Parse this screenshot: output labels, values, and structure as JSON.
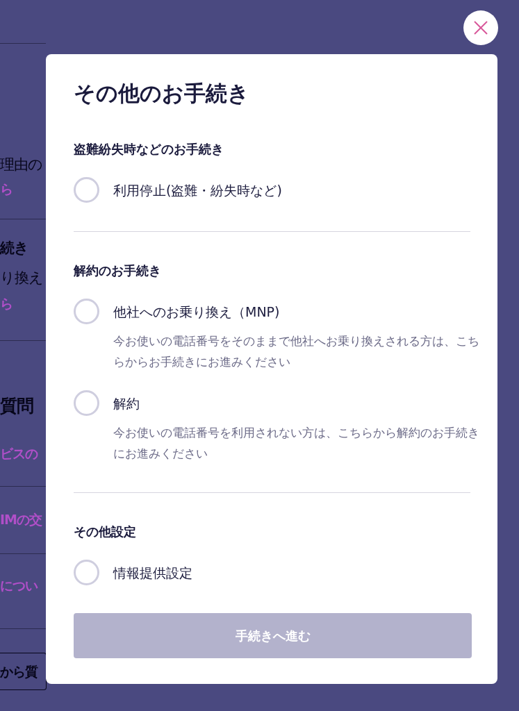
{
  "background": [
    {
      "kind": "text",
      "text": "理由の"
    },
    {
      "kind": "link",
      "text": "ら"
    },
    {
      "kind": "heading",
      "text": "続き"
    },
    {
      "kind": "text",
      "text": "り換え"
    },
    {
      "kind": "link",
      "text": "ら"
    },
    {
      "kind": "title",
      "text": "質問"
    },
    {
      "kind": "link",
      "text": "ビスの"
    },
    {
      "kind": "link",
      "text": "IMの交"
    },
    {
      "kind": "link",
      "text": "につい"
    },
    {
      "kind": "button",
      "text": "から質"
    }
  ],
  "dialog": {
    "title": "その他のお手続き",
    "sections": [
      {
        "heading": "盗難紛失時などのお手続き",
        "options": [
          {
            "label": "利用停止(盗難・紛失時など)",
            "selected": false
          }
        ]
      },
      {
        "heading": "解約のお手続き",
        "options": [
          {
            "label": "他社へのお乗り換え（MNP)",
            "description": "今お使いの電話番号をそのままで他社へお乗り換えされる方は、こちらからお手続きにお進みください",
            "selected": false
          },
          {
            "label": "解約",
            "description": "今お使いの電話番号を利用されない方は、こちらから解約のお手続きにお進みください",
            "selected": false
          }
        ]
      },
      {
        "heading": "その他設定",
        "options": [
          {
            "label": "情報提供設定",
            "selected": false
          }
        ]
      }
    ],
    "submit": {
      "label": "手続きへ進む",
      "disabled": true
    }
  }
}
